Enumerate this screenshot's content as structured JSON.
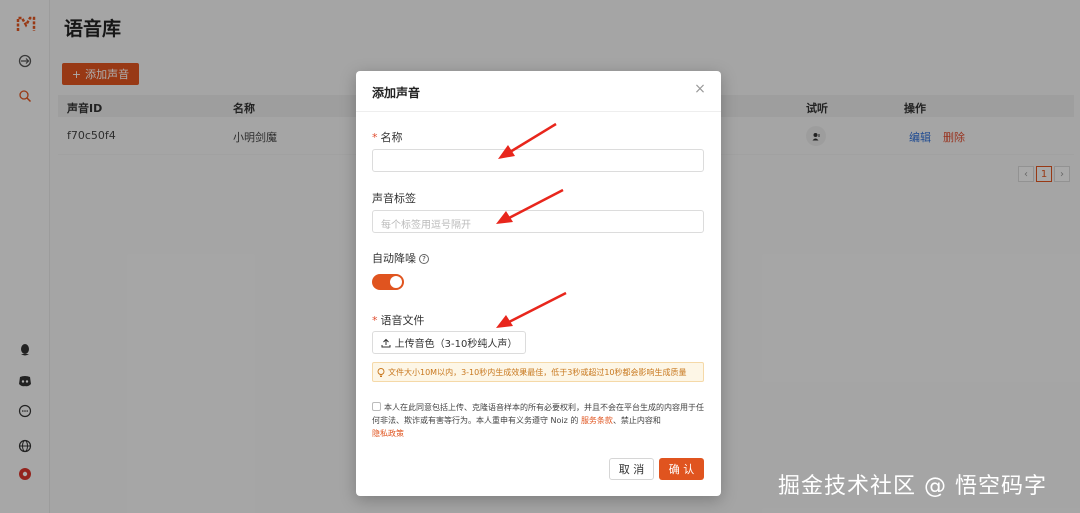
{
  "page": {
    "title": "语音库",
    "add_button_label": "添加声音",
    "table": {
      "columns": [
        "声音ID",
        "名称",
        "试听",
        "操作"
      ],
      "rows": [
        {
          "id": "f70c50f4",
          "name": "小明剑魔",
          "edit": "编辑",
          "delete": "删除"
        }
      ]
    },
    "pagination": {
      "prev": "‹",
      "current": "1",
      "next": "›"
    }
  },
  "modal": {
    "title": "添加声音",
    "close_glyph": "×",
    "name_label": "名称",
    "name_value": "",
    "tags_label": "声音标签",
    "tags_placeholder": "每个标签用逗号隔开",
    "denoise_label": "自动降噪",
    "denoise_on": true,
    "file_label": "语音文件",
    "upload_label": "上传音色（3-10秒纯人声）",
    "hint": "文件大小10M以内，3-10秒内生成效果最佳，低于3秒或超过10秒都会影响生成质量",
    "consent_text": "本人在此同意包括上传、克隆语音样本的所有必要权利，并且不会在平台生成的内容用于任何非法、欺诈或有害等行为。本人重申有义务遵守 Noiz 的 ",
    "terms_link": "服务条款",
    "consent_mid": "、禁止内容和",
    "privacy_link": "隐私政策",
    "cancel_label": "取 消",
    "ok_label": "确 认"
  },
  "colors": {
    "accent": "#e0541f",
    "annotation_arrow": "#e8261c"
  },
  "watermark": "掘金技术社区 @ 悟空码字"
}
